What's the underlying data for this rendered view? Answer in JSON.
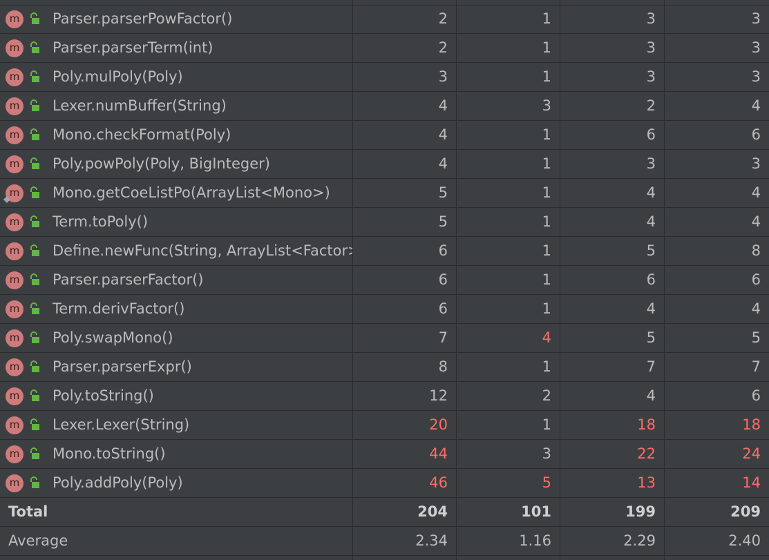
{
  "colors": {
    "background": "#3c3f41",
    "grid_line": "#2b2b2b",
    "text": "#bbbbbb",
    "highlight_red": "#ff6b68",
    "method_icon": "#cf7b7b",
    "lock_icon": "#62b543"
  },
  "icons": {
    "method": "method-m-icon",
    "visibility": "public-lock-icon"
  },
  "rows": [
    {
      "name": "Parser.parserPowFactor()",
      "v1": "2",
      "v2": "1",
      "v3": "3",
      "v4": "3",
      "red": [
        false,
        false,
        false,
        false
      ]
    },
    {
      "name": "Parser.parserTerm(int)",
      "v1": "2",
      "v2": "1",
      "v3": "3",
      "v4": "3",
      "red": [
        false,
        false,
        false,
        false
      ]
    },
    {
      "name": "Poly.mulPoly(Poly)",
      "v1": "3",
      "v2": "1",
      "v3": "3",
      "v4": "3",
      "red": [
        false,
        false,
        false,
        false
      ]
    },
    {
      "name": "Lexer.numBuffer(String)",
      "v1": "4",
      "v2": "3",
      "v3": "2",
      "v4": "4",
      "red": [
        false,
        false,
        false,
        false
      ]
    },
    {
      "name": "Mono.checkFormat(Poly)",
      "v1": "4",
      "v2": "1",
      "v3": "6",
      "v4": "6",
      "red": [
        false,
        false,
        false,
        false
      ]
    },
    {
      "name": "Poly.powPoly(Poly, BigInteger)",
      "v1": "4",
      "v2": "1",
      "v3": "3",
      "v4": "3",
      "red": [
        false,
        false,
        false,
        false
      ]
    },
    {
      "name": "Mono.getCoeListPo(ArrayList<Mono>)",
      "v1": "5",
      "v2": "1",
      "v3": "4",
      "v4": "4",
      "red": [
        false,
        false,
        false,
        false
      ],
      "marker": true
    },
    {
      "name": "Term.toPoly()",
      "v1": "5",
      "v2": "1",
      "v3": "4",
      "v4": "4",
      "red": [
        false,
        false,
        false,
        false
      ]
    },
    {
      "name": "Define.newFunc(String, ArrayList<Factor>",
      "v1": "6",
      "v2": "1",
      "v3": "5",
      "v4": "8",
      "red": [
        false,
        false,
        false,
        false
      ]
    },
    {
      "name": "Parser.parserFactor()",
      "v1": "6",
      "v2": "1",
      "v3": "6",
      "v4": "6",
      "red": [
        false,
        false,
        false,
        false
      ]
    },
    {
      "name": "Term.derivFactor()",
      "v1": "6",
      "v2": "1",
      "v3": "4",
      "v4": "4",
      "red": [
        false,
        false,
        false,
        false
      ]
    },
    {
      "name": "Poly.swapMono()",
      "v1": "7",
      "v2": "4",
      "v3": "5",
      "v4": "5",
      "red": [
        false,
        true,
        false,
        false
      ]
    },
    {
      "name": "Parser.parserExpr()",
      "v1": "8",
      "v2": "1",
      "v3": "7",
      "v4": "7",
      "red": [
        false,
        false,
        false,
        false
      ]
    },
    {
      "name": "Poly.toString()",
      "v1": "12",
      "v2": "2",
      "v3": "4",
      "v4": "6",
      "red": [
        false,
        false,
        false,
        false
      ]
    },
    {
      "name": "Lexer.Lexer(String)",
      "v1": "20",
      "v2": "1",
      "v3": "18",
      "v4": "18",
      "red": [
        true,
        false,
        true,
        true
      ]
    },
    {
      "name": "Mono.toString()",
      "v1": "44",
      "v2": "3",
      "v3": "22",
      "v4": "24",
      "red": [
        true,
        false,
        true,
        true
      ]
    },
    {
      "name": "Poly.addPoly(Poly)",
      "v1": "46",
      "v2": "5",
      "v3": "13",
      "v4": "14",
      "red": [
        true,
        true,
        true,
        true
      ]
    }
  ],
  "total": {
    "label": "Total",
    "v1": "204",
    "v2": "101",
    "v3": "199",
    "v4": "209"
  },
  "average": {
    "label": "Average",
    "v1": "2.34",
    "v2": "1.16",
    "v3": "2.29",
    "v4": "2.40"
  }
}
